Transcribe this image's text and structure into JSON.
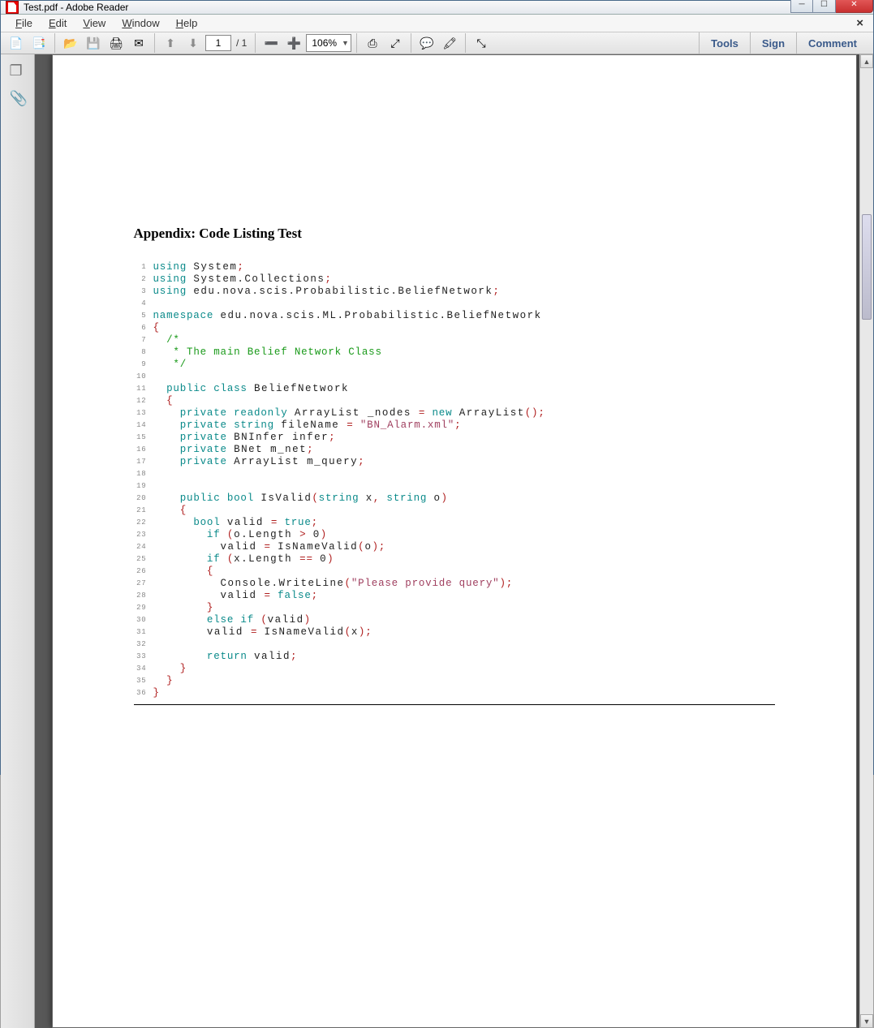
{
  "window": {
    "title": "Test.pdf - Adobe Reader"
  },
  "menubar": {
    "items": [
      "File",
      "Edit",
      "View",
      "Window",
      "Help"
    ]
  },
  "toolbar": {
    "page_current": "1",
    "page_total": "/ 1",
    "zoom": "106%",
    "right_items": [
      "Tools",
      "Sign",
      "Comment"
    ]
  },
  "document": {
    "heading": "Appendix: Code Listing Test",
    "code": [
      {
        "n": 1,
        "tokens": [
          [
            "kw",
            "using "
          ],
          [
            "id",
            "System"
          ],
          [
            "brace",
            ";"
          ]
        ]
      },
      {
        "n": 2,
        "tokens": [
          [
            "kw",
            "using "
          ],
          [
            "id",
            "System.Collections"
          ],
          [
            "brace",
            ";"
          ]
        ]
      },
      {
        "n": 3,
        "tokens": [
          [
            "kw",
            "using "
          ],
          [
            "id",
            "edu.nova.scis.Probabilistic.BeliefNetwork"
          ],
          [
            "brace",
            ";"
          ]
        ]
      },
      {
        "n": 4,
        "tokens": []
      },
      {
        "n": 5,
        "tokens": [
          [
            "kw",
            "namespace "
          ],
          [
            "id",
            "edu.nova.scis.ML.Probabilistic.BeliefNetwork"
          ]
        ]
      },
      {
        "n": 6,
        "tokens": [
          [
            "brace",
            "{"
          ]
        ]
      },
      {
        "n": 7,
        "tokens": [
          [
            "",
            "  "
          ],
          [
            "com",
            "/*"
          ]
        ]
      },
      {
        "n": 8,
        "tokens": [
          [
            "",
            "  "
          ],
          [
            "com",
            " * The main Belief Network Class"
          ]
        ]
      },
      {
        "n": 9,
        "tokens": [
          [
            "",
            "  "
          ],
          [
            "com",
            " */"
          ]
        ]
      },
      {
        "n": 10,
        "tokens": []
      },
      {
        "n": 11,
        "tokens": [
          [
            "",
            "  "
          ],
          [
            "kw",
            "public class "
          ],
          [
            "id",
            "BeliefNetwork"
          ]
        ]
      },
      {
        "n": 12,
        "tokens": [
          [
            "",
            "  "
          ],
          [
            "brace",
            "{"
          ]
        ]
      },
      {
        "n": 13,
        "tokens": [
          [
            "",
            "    "
          ],
          [
            "kw",
            "private readonly "
          ],
          [
            "id",
            "ArrayList _nodes "
          ],
          [
            "brace",
            "= "
          ],
          [
            "kw",
            "new "
          ],
          [
            "id",
            "ArrayList"
          ],
          [
            "brace",
            "();"
          ]
        ]
      },
      {
        "n": 14,
        "tokens": [
          [
            "",
            "    "
          ],
          [
            "kw",
            "private string "
          ],
          [
            "id",
            "fileName "
          ],
          [
            "brace",
            "= "
          ],
          [
            "str",
            "\"BN_Alarm.xml\""
          ],
          [
            "brace",
            ";"
          ]
        ]
      },
      {
        "n": 15,
        "tokens": [
          [
            "",
            "    "
          ],
          [
            "kw",
            "private "
          ],
          [
            "id",
            "BNInfer infer"
          ],
          [
            "brace",
            ";"
          ]
        ]
      },
      {
        "n": 16,
        "tokens": [
          [
            "",
            "    "
          ],
          [
            "kw",
            "private "
          ],
          [
            "id",
            "BNet m_net"
          ],
          [
            "brace",
            ";"
          ]
        ]
      },
      {
        "n": 17,
        "tokens": [
          [
            "",
            "    "
          ],
          [
            "kw",
            "private "
          ],
          [
            "id",
            "ArrayList m_query"
          ],
          [
            "brace",
            ";"
          ]
        ]
      },
      {
        "n": 18,
        "tokens": []
      },
      {
        "n": 19,
        "tokens": []
      },
      {
        "n": 20,
        "tokens": [
          [
            "",
            "    "
          ],
          [
            "kw",
            "public bool "
          ],
          [
            "id",
            "IsValid"
          ],
          [
            "brace",
            "("
          ],
          [
            "kw",
            "string "
          ],
          [
            "id",
            "x"
          ],
          [
            "brace",
            ", "
          ],
          [
            "kw",
            "string "
          ],
          [
            "id",
            "o"
          ],
          [
            "brace",
            ")"
          ]
        ]
      },
      {
        "n": 21,
        "tokens": [
          [
            "",
            "    "
          ],
          [
            "brace",
            "{"
          ]
        ]
      },
      {
        "n": 22,
        "tokens": [
          [
            "",
            "      "
          ],
          [
            "kw",
            "bool "
          ],
          [
            "id",
            "valid "
          ],
          [
            "brace",
            "= "
          ],
          [
            "kw",
            "true"
          ],
          [
            "brace",
            ";"
          ]
        ]
      },
      {
        "n": 23,
        "tokens": [
          [
            "",
            "        "
          ],
          [
            "kw",
            "if "
          ],
          [
            "brace",
            "("
          ],
          [
            "id",
            "o.Length "
          ],
          [
            "brace",
            "> "
          ],
          [
            "id",
            "0"
          ],
          [
            "brace",
            ")"
          ]
        ]
      },
      {
        "n": 24,
        "tokens": [
          [
            "",
            "          "
          ],
          [
            "id",
            "valid "
          ],
          [
            "brace",
            "= "
          ],
          [
            "id",
            "IsNameValid"
          ],
          [
            "brace",
            "("
          ],
          [
            "id",
            "o"
          ],
          [
            "brace",
            ");"
          ]
        ]
      },
      {
        "n": 25,
        "tokens": [
          [
            "",
            "        "
          ],
          [
            "kw",
            "if "
          ],
          [
            "brace",
            "("
          ],
          [
            "id",
            "x.Length "
          ],
          [
            "brace",
            "== "
          ],
          [
            "id",
            "0"
          ],
          [
            "brace",
            ")"
          ]
        ]
      },
      {
        "n": 26,
        "tokens": [
          [
            "",
            "        "
          ],
          [
            "brace",
            "{"
          ]
        ]
      },
      {
        "n": 27,
        "tokens": [
          [
            "",
            "          "
          ],
          [
            "id",
            "Console.WriteLine"
          ],
          [
            "brace",
            "("
          ],
          [
            "str",
            "\"Please provide query\""
          ],
          [
            "brace",
            ");"
          ]
        ]
      },
      {
        "n": 28,
        "tokens": [
          [
            "",
            "          "
          ],
          [
            "id",
            "valid "
          ],
          [
            "brace",
            "= "
          ],
          [
            "kw",
            "false"
          ],
          [
            "brace",
            ";"
          ]
        ]
      },
      {
        "n": 29,
        "tokens": [
          [
            "",
            "        "
          ],
          [
            "brace",
            "}"
          ]
        ]
      },
      {
        "n": 30,
        "tokens": [
          [
            "",
            "        "
          ],
          [
            "kw",
            "else if "
          ],
          [
            "brace",
            "("
          ],
          [
            "id",
            "valid"
          ],
          [
            "brace",
            ")"
          ]
        ]
      },
      {
        "n": 31,
        "tokens": [
          [
            "",
            "        "
          ],
          [
            "id",
            "valid "
          ],
          [
            "brace",
            "= "
          ],
          [
            "id",
            "IsNameValid"
          ],
          [
            "brace",
            "("
          ],
          [
            "id",
            "x"
          ],
          [
            "brace",
            ");"
          ]
        ]
      },
      {
        "n": 32,
        "tokens": []
      },
      {
        "n": 33,
        "tokens": [
          [
            "",
            "        "
          ],
          [
            "kw",
            "return "
          ],
          [
            "id",
            "valid"
          ],
          [
            "brace",
            ";"
          ]
        ]
      },
      {
        "n": 34,
        "tokens": [
          [
            "",
            "    "
          ],
          [
            "brace",
            "}"
          ]
        ]
      },
      {
        "n": 35,
        "tokens": [
          [
            "",
            "  "
          ],
          [
            "brace",
            "}"
          ]
        ]
      },
      {
        "n": 36,
        "tokens": [
          [
            "brace",
            "}"
          ]
        ]
      }
    ]
  }
}
